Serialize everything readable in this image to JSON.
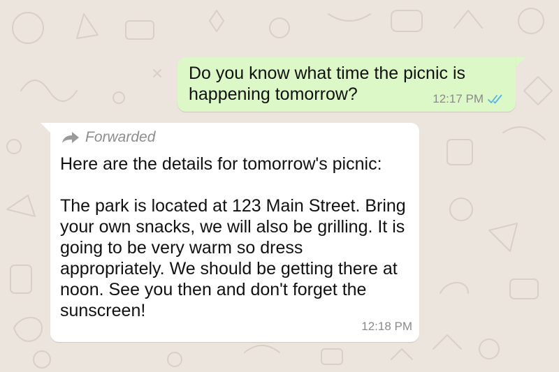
{
  "chat": {
    "messages": [
      {
        "direction": "outgoing",
        "text": "Do you know what time the picnic is happening tomorrow?",
        "time": "12:17 PM",
        "status_icon": "double-check-read-icon"
      },
      {
        "direction": "incoming",
        "forwarded_label": "Forwarded",
        "forwarded_icon": "forward-arrow-icon",
        "text": "Here are the details for tomorrow's picnic:\n\nThe park is located at 123 Main Street. Bring your own snacks, we will also be grilling. It is going to be very warm so dress appropriately. We should be getting there at noon. See you then and don't forget the sunscreen!",
        "time": "12:18 PM"
      }
    ]
  },
  "colors": {
    "wallpaper": "#ece5dd",
    "outgoing_bubble": "#dcf8c6",
    "incoming_bubble": "#ffffff",
    "read_ticks": "#4fb6ec"
  }
}
